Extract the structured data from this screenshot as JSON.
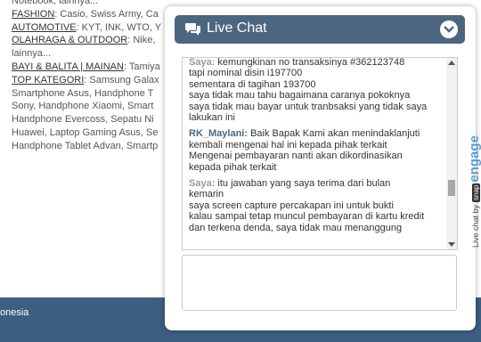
{
  "background": {
    "lines": [
      {
        "cat": "",
        "text": "Notebook, lainnya..."
      },
      {
        "cat": "FASHION",
        "text": ": Casio, Swiss Army, Ca"
      },
      {
        "cat": "AUTOMOTIVE",
        "text": ": KYT, INK, WTO, Y"
      },
      {
        "cat": "OLAHRAGA & OUTDOOR",
        "text": ": Nike,"
      },
      {
        "cat": "",
        "text": "lainnya..."
      },
      {
        "cat": "BAYI & BALITA | MAINAN",
        "text": ": Tamiya"
      },
      {
        "cat": "TOP KATEGORI",
        "text": ": Samsung Galax"
      },
      {
        "cat": "",
        "text": "Smartphone Asus, Handphone T"
      },
      {
        "cat": "",
        "text": "Sony, Handphone Xiaomi, Smart"
      },
      {
        "cat": "",
        "text": "Handphone Evercoss, Sepatu Ni"
      },
      {
        "cat": "",
        "text": "Huawei, Laptop Gaming Asus, Se"
      },
      {
        "cat": "",
        "text": "Handphone Tablet Advan, Smartp"
      }
    ],
    "footer_label": "onesia"
  },
  "chat": {
    "title": "Live Chat",
    "messages": [
      {
        "role": "user",
        "sender": "Saya:",
        "lines": [
          "kemungkinan no transaksinya #362123748",
          "tapi nominal disin i197700",
          "sementara di tagihan 193700",
          "saya tidak mau tahu bagaimana caranya pokoknya",
          "saya tidak mau bayar untuk tranbsaksi yang tidak saya",
          "lakukan ini"
        ]
      },
      {
        "role": "agent",
        "sender": "RK_Maylani:",
        "lines": [
          "Baik Bapak Kami akan menindaklanjuti",
          "kembali mengenai hal ini kepada pihak terkait",
          "Mengenai pembayaran nanti akan dikordinasikan",
          "kepada pihak terkait"
        ]
      },
      {
        "role": "user",
        "sender": "Saya:",
        "lines": [
          "itu jawaban yang saya terima dari bulan",
          "kemarin",
          "saya screen capture percakapan ini untuk bukti",
          "kalau sampai tetap muncul pembayaran di kartu kredit",
          "dan terkena denda, saya tidak mau menanggung"
        ]
      }
    ],
    "brand": {
      "prefix": "Live chat by",
      "snap": "snap",
      "engage": "engage"
    },
    "input_value": ""
  },
  "colors": {
    "header": "#4d6680",
    "footer": "#3d5e80",
    "agent_name": "#4a6882",
    "user_name": "#999999",
    "engage": "#5b9bd5"
  },
  "icons": [
    "chat-bubbles-icon",
    "chevron-down-icon"
  ]
}
